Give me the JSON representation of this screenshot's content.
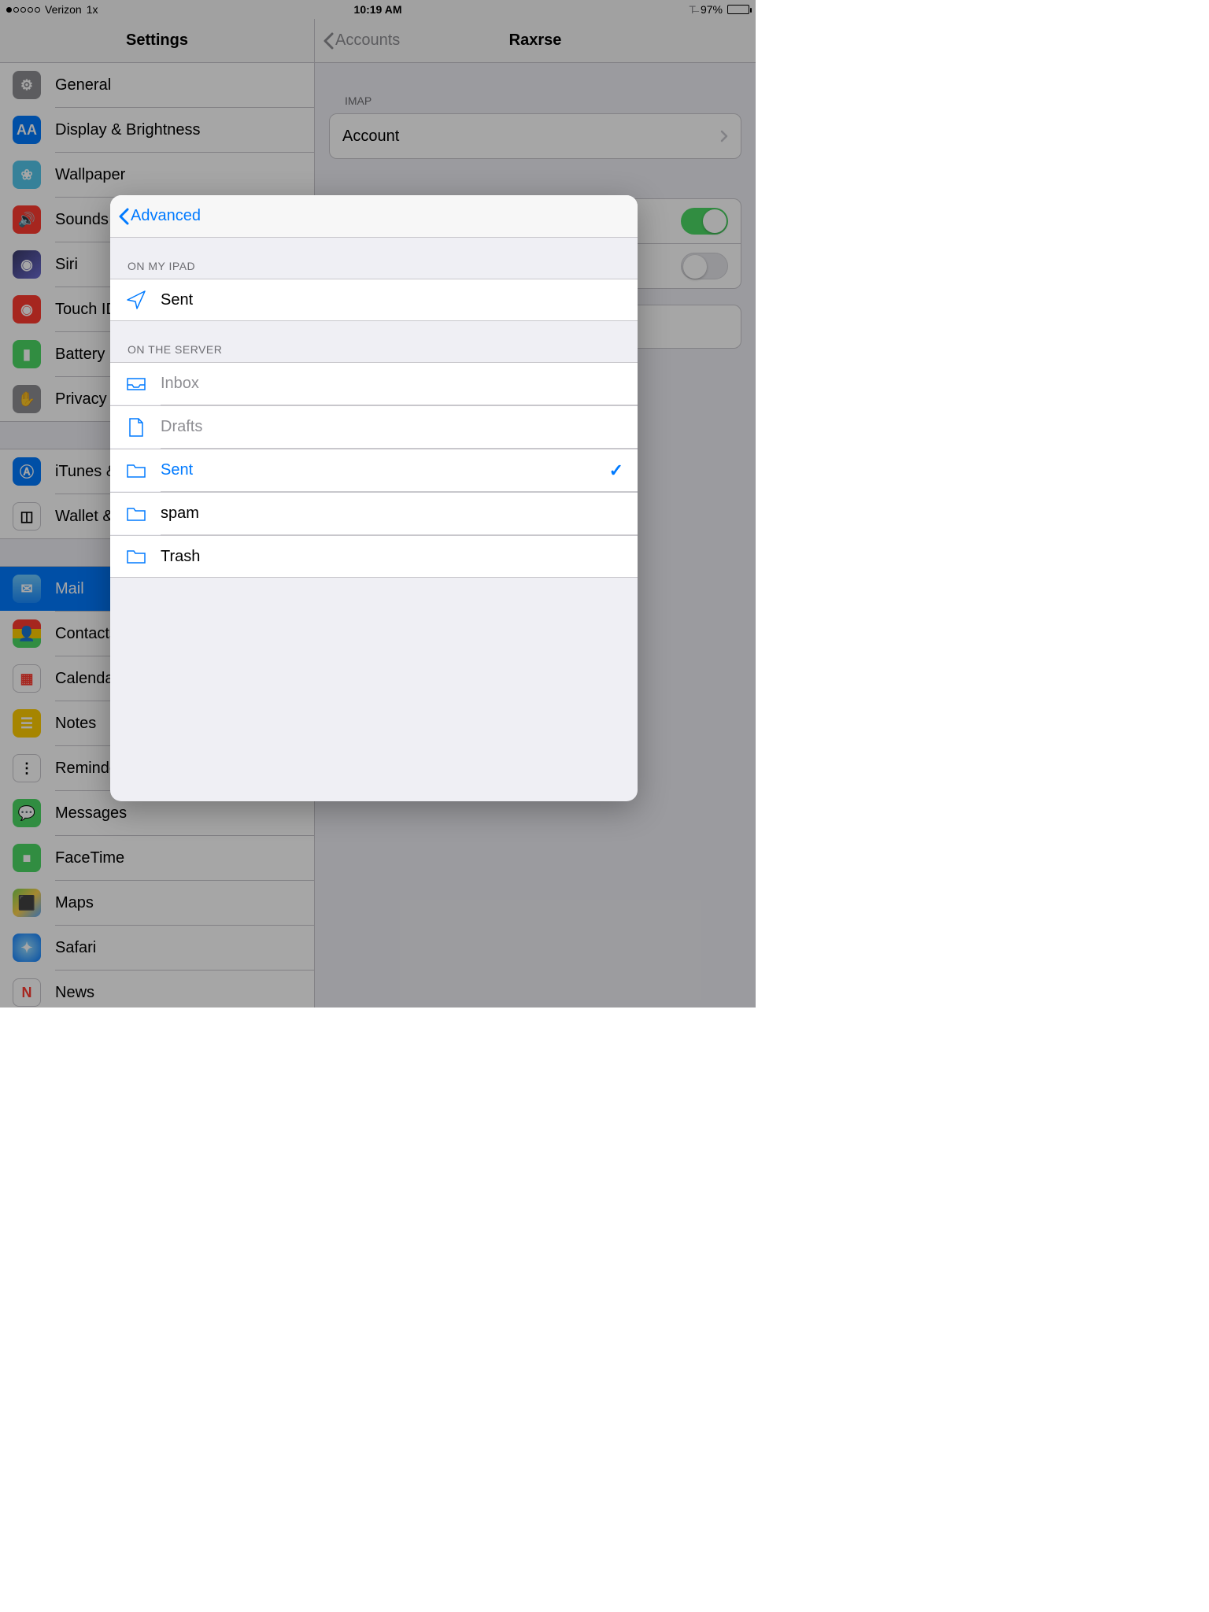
{
  "status": {
    "carrier": "Verizon",
    "network": "1x",
    "time": "10:19 AM",
    "battery": "97%"
  },
  "sidebar": {
    "title": "Settings",
    "group1": [
      "General",
      "Display & Brightness",
      "Wallpaper",
      "Sounds",
      "Siri",
      "Touch ID & Passcode",
      "Battery",
      "Privacy"
    ],
    "group2": [
      "iTunes & App Store",
      "Wallet & Apple Pay"
    ],
    "group3": [
      "Mail",
      "Contacts",
      "Calendar",
      "Notes",
      "Reminders",
      "Messages",
      "FaceTime",
      "Maps",
      "Safari",
      "News"
    ]
  },
  "detail": {
    "back": "Accounts",
    "title": "Raxrse",
    "section1": "IMAP",
    "account": "Account"
  },
  "popover": {
    "back": "Advanced",
    "section1": "ON MY IPAD",
    "local": [
      "Sent"
    ],
    "section2": "ON THE SERVER",
    "server": [
      "Inbox",
      "Drafts",
      "Sent",
      "spam",
      "Trash"
    ],
    "selected_server_index": 2
  }
}
